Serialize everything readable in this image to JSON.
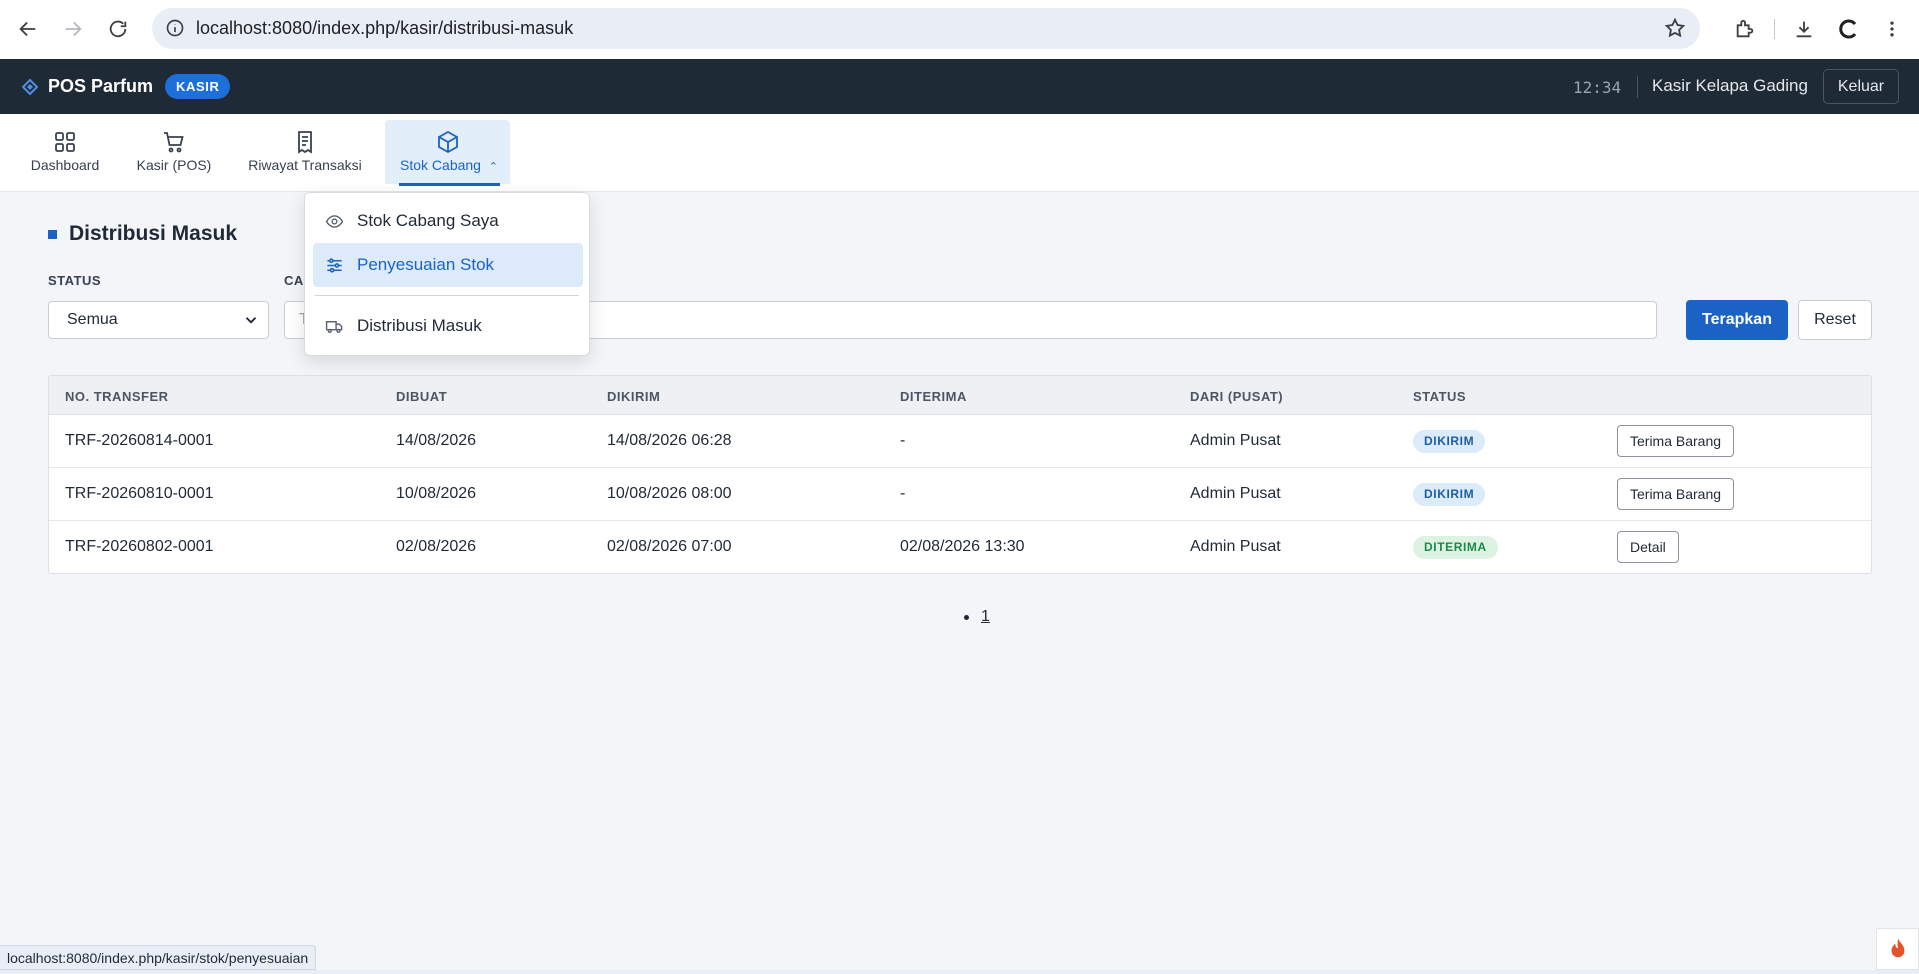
{
  "browser": {
    "url": "localhost:8080/index.php/kasir/distribusi-masuk",
    "status_url": "localhost:8080/index.php/kasir/stok/penyesuaian"
  },
  "header": {
    "brand": "POS Parfum",
    "role_badge": "KASIR",
    "clock": "12:34",
    "user_name": "Kasir Kelapa Gading",
    "logout_label": "Keluar"
  },
  "nav": {
    "tabs": [
      {
        "label": "Dashboard",
        "icon": "grid-icon"
      },
      {
        "label": "Kasir (POS)",
        "icon": "cart-icon"
      },
      {
        "label": "Riwayat Transaksi",
        "icon": "receipt-icon"
      },
      {
        "label": "Stok Cabang",
        "icon": "box-icon",
        "active": true
      }
    ],
    "dropdown": [
      {
        "label": "Stok Cabang Saya",
        "icon": "eye-icon"
      },
      {
        "label": "Penyesuaian Stok",
        "icon": "sliders-icon",
        "hover": true
      },
      {
        "label": "Distribusi Masuk",
        "icon": "truck-icon"
      }
    ]
  },
  "page": {
    "title": "Distribusi Masuk",
    "filters": {
      "status_label": "STATUS",
      "status_value": "Semua",
      "search_label": "CA",
      "search_placeholder": "T",
      "apply_label": "Terapkan",
      "reset_label": "Reset"
    }
  },
  "table": {
    "columns": [
      "NO. TRANSFER",
      "DIBUAT",
      "DIKIRIM",
      "DITERIMA",
      "DARI (PUSAT)",
      "STATUS"
    ],
    "rows": [
      {
        "no": "TRF-20260814-0001",
        "dibuat": "14/08/2026",
        "dikirim": "14/08/2026 06:28",
        "diterima": "-",
        "dari": "Admin Pusat",
        "status": "DIKIRIM",
        "action": "Terima Barang"
      },
      {
        "no": "TRF-20260810-0001",
        "dibuat": "10/08/2026",
        "dikirim": "10/08/2026 08:00",
        "diterima": "-",
        "dari": "Admin Pusat",
        "status": "DIKIRIM",
        "action": "Terima Barang"
      },
      {
        "no": "TRF-20260802-0001",
        "dibuat": "02/08/2026",
        "dikirim": "02/08/2026 07:00",
        "diterima": "02/08/2026 13:30",
        "dari": "Admin Pusat",
        "status": "DITERIMA",
        "action": "Detail"
      }
    ]
  },
  "pagination": {
    "current": "1"
  },
  "colors": {
    "primary": "#1a63c5",
    "header_bg": "#1f2a37",
    "sent_pill": "#dcebfa",
    "received_pill": "#dcf3e3"
  }
}
